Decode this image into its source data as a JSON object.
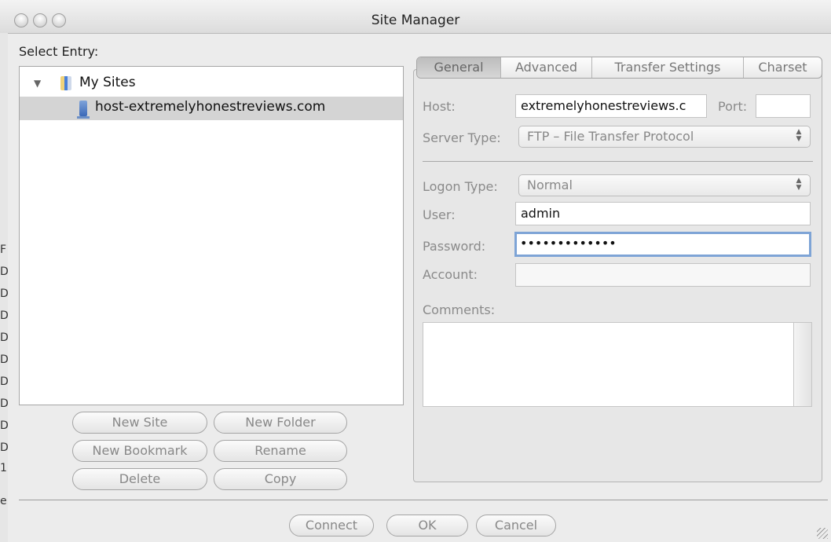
{
  "window": {
    "title": "Site Manager"
  },
  "left": {
    "select_entry_label": "Select Entry:",
    "tree": [
      {
        "label": "My Sites",
        "type": "folder",
        "expanded": true
      },
      {
        "label": "host-extremelyhonestreviews.com",
        "type": "site",
        "selected": true
      }
    ],
    "buttons": {
      "new_site": "New Site",
      "new_folder": "New Folder",
      "new_bookmark": "New Bookmark",
      "rename": "Rename",
      "delete": "Delete",
      "copy": "Copy"
    }
  },
  "tabs": [
    "General",
    "Advanced",
    "Transfer Settings",
    "Charset"
  ],
  "active_tab": "General",
  "general": {
    "host_label": "Host:",
    "host_value": "extremelyhonestreviews.c",
    "port_label": "Port:",
    "port_value": "",
    "server_type_label": "Server Type:",
    "server_type_value": "FTP – File Transfer Protocol",
    "logon_type_label": "Logon Type:",
    "logon_type_value": "Normal",
    "user_label": "User:",
    "user_value": "admin",
    "password_label": "Password:",
    "password_value": "•••••••••••••",
    "account_label": "Account:",
    "account_value": "",
    "comments_label": "Comments:"
  },
  "footer": {
    "connect": "Connect",
    "ok": "OK",
    "cancel": "Cancel"
  },
  "background_window_chars": [
    "F",
    "D",
    "D",
    "D",
    "D",
    "D",
    "D",
    "D",
    "D",
    "D",
    "1",
    "e"
  ]
}
